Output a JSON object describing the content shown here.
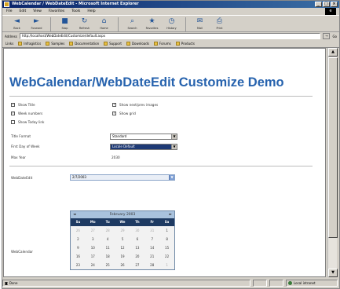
{
  "window": {
    "title": "WebCalendar / WebDateEdit - Microsoft Internet Explorer"
  },
  "menu": [
    "File",
    "Edit",
    "View",
    "Favorites",
    "Tools",
    "Help"
  ],
  "toolbar": [
    {
      "label": "Back",
      "icon": "back-arrow-icon"
    },
    {
      "label": "Forward",
      "icon": "forward-arrow-icon"
    },
    {
      "label": "Stop",
      "icon": "stop-icon"
    },
    {
      "label": "Refresh",
      "icon": "refresh-icon"
    },
    {
      "label": "Home",
      "icon": "home-icon"
    },
    {
      "label": "Search",
      "icon": "search-icon"
    },
    {
      "label": "Favorites",
      "icon": "favorites-icon"
    },
    {
      "label": "History",
      "icon": "history-icon"
    },
    {
      "label": "Mail",
      "icon": "mail-icon"
    },
    {
      "label": "Print",
      "icon": "print-icon"
    }
  ],
  "address": {
    "label": "Address",
    "url": "http://localhost/WebDateEdit/Customize/default.aspx",
    "go": "Go",
    "links": "Links"
  },
  "links": [
    "Infragistics",
    "Samples",
    "Documentation",
    "Support",
    "Downloads",
    "Forums",
    "Products"
  ],
  "page": {
    "title": "WebCalendar/WebDateEdit Customize Demo",
    "checkboxes": {
      "show_title": "Show Title",
      "week_num": "Week numbers",
      "show_today": "Show Today link",
      "show_next_prev": "Show next/prev images",
      "show_grid": "Show grid"
    },
    "form": {
      "title_format_label": "Title Format",
      "title_format_value": "Standard",
      "first_day_label": "First Day of Week",
      "first_day_value": "Locale Default",
      "max_year_label": "Max Year",
      "max_year_value": "2030",
      "date_edit_label": "WebDateEdit",
      "date_edit_value": "2/7/2003",
      "calendar_label": "WebCalendar"
    },
    "calendar": {
      "title": "February 2003",
      "prev": "◄",
      "next": "►",
      "dow": [
        "Su",
        "Mo",
        "Tu",
        "We",
        "Th",
        "Fr",
        "Sa"
      ],
      "rows": [
        [
          {
            "d": "26",
            "o": true
          },
          {
            "d": "27",
            "o": true
          },
          {
            "d": "28",
            "o": true
          },
          {
            "d": "29",
            "o": true
          },
          {
            "d": "30",
            "o": true
          },
          {
            "d": "31",
            "o": true
          },
          {
            "d": "1",
            "o": false
          }
        ],
        [
          {
            "d": "2",
            "o": false
          },
          {
            "d": "3",
            "o": false
          },
          {
            "d": "4",
            "o": false
          },
          {
            "d": "5",
            "o": false
          },
          {
            "d": "6",
            "o": false
          },
          {
            "d": "7",
            "o": false
          },
          {
            "d": "8",
            "o": false
          }
        ],
        [
          {
            "d": "9",
            "o": false
          },
          {
            "d": "10",
            "o": false
          },
          {
            "d": "11",
            "o": false
          },
          {
            "d": "12",
            "o": false
          },
          {
            "d": "13",
            "o": false
          },
          {
            "d": "14",
            "o": false
          },
          {
            "d": "15",
            "o": false
          }
        ],
        [
          {
            "d": "16",
            "o": false
          },
          {
            "d": "17",
            "o": false
          },
          {
            "d": "18",
            "o": false
          },
          {
            "d": "19",
            "o": false
          },
          {
            "d": "20",
            "o": false
          },
          {
            "d": "21",
            "o": false
          },
          {
            "d": "22",
            "o": false
          }
        ],
        [
          {
            "d": "23",
            "o": false
          },
          {
            "d": "24",
            "o": false
          },
          {
            "d": "25",
            "o": false
          },
          {
            "d": "26",
            "o": false
          },
          {
            "d": "27",
            "o": false
          },
          {
            "d": "28",
            "o": false
          },
          {
            "d": "1",
            "o": true
          }
        ]
      ]
    }
  },
  "status": {
    "left": "Done",
    "zone": "Local intranet"
  },
  "colors": {
    "title": "#2763ae",
    "calendar_dow": "#1e3a62",
    "calendar_header": "#a9c2dd"
  }
}
